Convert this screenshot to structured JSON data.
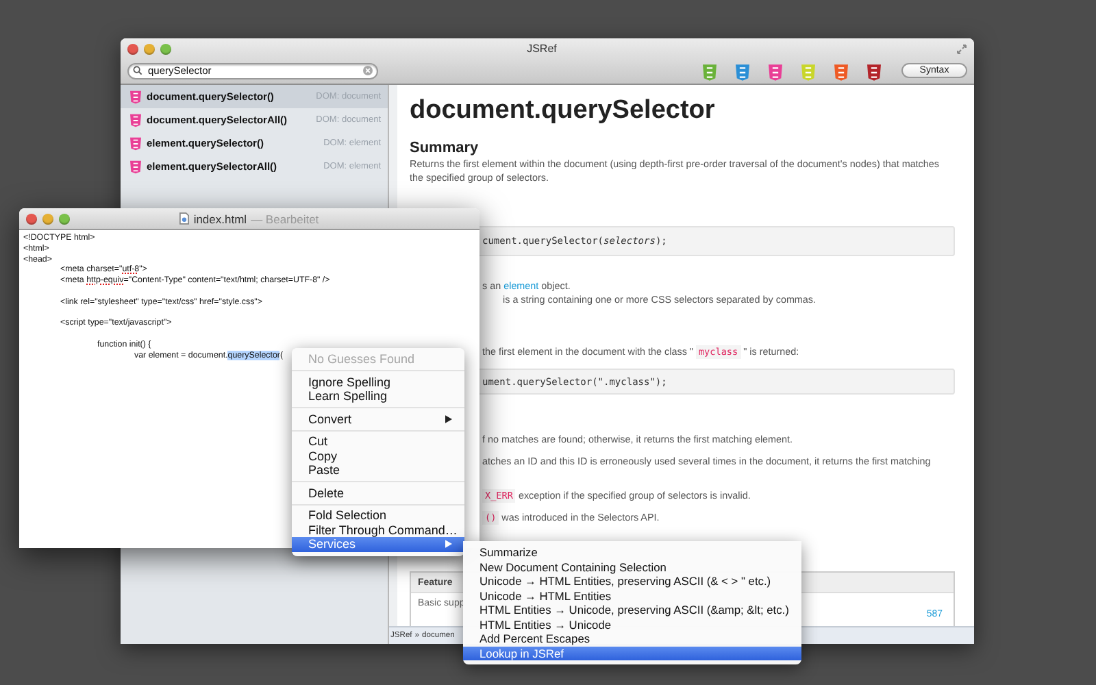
{
  "jsref_window": {
    "title": "JSRef",
    "search": {
      "value": "querySelector"
    },
    "library_icons": [
      {
        "color": "#6ab23a"
      },
      {
        "color": "#2b8fd6"
      },
      {
        "color": "#e93f96"
      },
      {
        "color": "#c9d62a"
      },
      {
        "color": "#ee5a25"
      },
      {
        "color": "#b3242a"
      }
    ],
    "syntax_button": "Syntax",
    "sidebar": {
      "items": [
        {
          "name": "document.querySelector()",
          "category": "DOM: document",
          "selected": true
        },
        {
          "name": "document.querySelectorAll()",
          "category": "DOM: document",
          "selected": false
        },
        {
          "name": "element.querySelector()",
          "category": "DOM: element",
          "selected": false
        },
        {
          "name": "element.querySelectorAll()",
          "category": "DOM: element",
          "selected": false
        }
      ]
    },
    "doc": {
      "blocks": [
        {
          "kind": "title",
          "text": "document.querySelector"
        },
        {
          "kind": "heading",
          "text": "Summary"
        },
        {
          "kind": "para",
          "segments": [
            {
              "kind": "text",
              "text": "Returns the first element within the document (using depth-first pre-order traversal of the document's nodes) that matches the specified group of selectors."
            }
          ]
        },
        {
          "kind": "code",
          "text": "cument.querySelector(*selectors*);"
        },
        {
          "kind": "fragment",
          "segments": [
            {
              "kind": "text",
              "text": "s an "
            },
            {
              "kind": "link",
              "text": "element"
            },
            {
              "kind": "text",
              "text": " object."
            }
          ]
        },
        {
          "kind": "fragment_indented",
          "segments": [
            {
              "kind": "text",
              "text": "is a string containing one or more CSS selectors separated by commas."
            }
          ]
        },
        {
          "kind": "fragment_spaced",
          "segments": [
            {
              "kind": "text",
              "text": "the first element in the document with the class \" "
            },
            {
              "kind": "code",
              "text": "myclass"
            },
            {
              "kind": "text",
              "text": " \" is returned:"
            }
          ]
        },
        {
          "kind": "code",
          "text": "ument.querySelector(\".myclass\");"
        },
        {
          "kind": "fragment_spaced",
          "segments": [
            {
              "kind": "text",
              "text": "f no matches are found; otherwise, it returns the first matching element."
            }
          ]
        },
        {
          "kind": "fragment",
          "segments": [
            {
              "kind": "text",
              "text": "atches an ID and this ID is erroneously used several times in the document, it returns the first matching"
            }
          ]
        },
        {
          "kind": "fragment_loose",
          "segments": [
            {
              "kind": "code",
              "text": "X_ERR"
            },
            {
              "kind": "text",
              "text": " exception if the specified group of selectors is invalid."
            }
          ]
        },
        {
          "kind": "fragment",
          "segments": [
            {
              "kind": "code",
              "text": "()"
            },
            {
              "kind": "text",
              "text": " was introduced in the Selectors API."
            }
          ]
        },
        {
          "kind": "table",
          "columns": [
            "Feature"
          ],
          "rows": [
            {
              "cells": [
                "Basic supp"
              ],
              "link": "587"
            }
          ]
        }
      ]
    },
    "breadcrumb": [
      "JSRef",
      "»",
      "documen"
    ]
  },
  "editor_window": {
    "title": "index.html",
    "status": "— Bearbeitet",
    "lines": [
      {
        "gap_before": false,
        "segments": [
          {
            "kind": "plain",
            "text": "<!DOCTYPE html>"
          }
        ]
      },
      {
        "gap_before": false,
        "segments": [
          {
            "kind": "plain",
            "text": "<html>"
          }
        ]
      },
      {
        "gap_before": false,
        "segments": [
          {
            "kind": "plain",
            "text": "<head>"
          }
        ]
      },
      {
        "gap_before": false,
        "segments": [
          {
            "kind": "plain",
            "text": "\t<meta charset=\""
          },
          {
            "kind": "misspelled",
            "text": "utf-8"
          },
          {
            "kind": "plain",
            "text": "\">"
          }
        ]
      },
      {
        "gap_before": false,
        "segments": [
          {
            "kind": "plain",
            "text": "\t<meta "
          },
          {
            "kind": "misspelled",
            "text": "http-equiv"
          },
          {
            "kind": "plain",
            "text": "=\"Content-Type\" content=\"text/html; charset=UTF-8\" />"
          }
        ]
      },
      {
        "gap_before": true,
        "segments": [
          {
            "kind": "plain",
            "text": "\t<link rel=\"stylesheet\" type=\"text/css\" href=\"style.css\">"
          }
        ]
      },
      {
        "gap_before": true,
        "segments": [
          {
            "kind": "plain",
            "text": "\t<script type=\"text/javascript\">"
          }
        ]
      },
      {
        "gap_before": true,
        "segments": [
          {
            "kind": "plain",
            "text": "\t\tfunction init() {"
          }
        ]
      },
      {
        "gap_before": false,
        "segments": [
          {
            "kind": "plain",
            "text": "\t\t\tvar element = document."
          },
          {
            "kind": "selected",
            "text": "querySelector"
          },
          {
            "kind": "plain",
            "text": "("
          }
        ]
      }
    ]
  },
  "context_menu": {
    "groups": [
      [
        {
          "label": "No Guesses Found",
          "disabled": true,
          "submenu": false,
          "selected": false
        }
      ],
      [
        {
          "label": "Ignore Spelling",
          "disabled": false,
          "submenu": false,
          "selected": false
        },
        {
          "label": "Learn Spelling",
          "disabled": false,
          "submenu": false,
          "selected": false
        }
      ],
      [
        {
          "label": "Convert",
          "disabled": false,
          "submenu": true,
          "selected": false
        }
      ],
      [
        {
          "label": "Cut",
          "disabled": false,
          "submenu": false,
          "selected": false
        },
        {
          "label": "Copy",
          "disabled": false,
          "submenu": false,
          "selected": false
        },
        {
          "label": "Paste",
          "disabled": false,
          "submenu": false,
          "selected": false
        }
      ],
      [
        {
          "label": "Delete",
          "disabled": false,
          "submenu": false,
          "selected": false
        }
      ],
      [
        {
          "label": "Fold Selection",
          "disabled": false,
          "submenu": false,
          "selected": false
        },
        {
          "label": "Filter Through Command…",
          "disabled": false,
          "submenu": false,
          "selected": false
        },
        {
          "label": "Services",
          "disabled": false,
          "submenu": true,
          "selected": true
        }
      ]
    ]
  },
  "services_menu": {
    "items": [
      {
        "label": "Summarize",
        "selected": false
      },
      {
        "label": "New Document Containing Selection",
        "selected": false
      },
      {
        "label": "Unicode → HTML Entities, preserving ASCII (& < > \" etc.)",
        "selected": false
      },
      {
        "label": "Unicode → HTML Entities",
        "selected": false
      },
      {
        "label": "HTML Entities → Unicode, preserving ASCII (&amp; &lt; etc.)",
        "selected": false
      },
      {
        "label": "HTML Entities → Unicode",
        "selected": false
      },
      {
        "label": "Add Percent Escapes",
        "selected": false
      },
      {
        "label": "Lookup in JSRef",
        "selected": true
      }
    ]
  }
}
